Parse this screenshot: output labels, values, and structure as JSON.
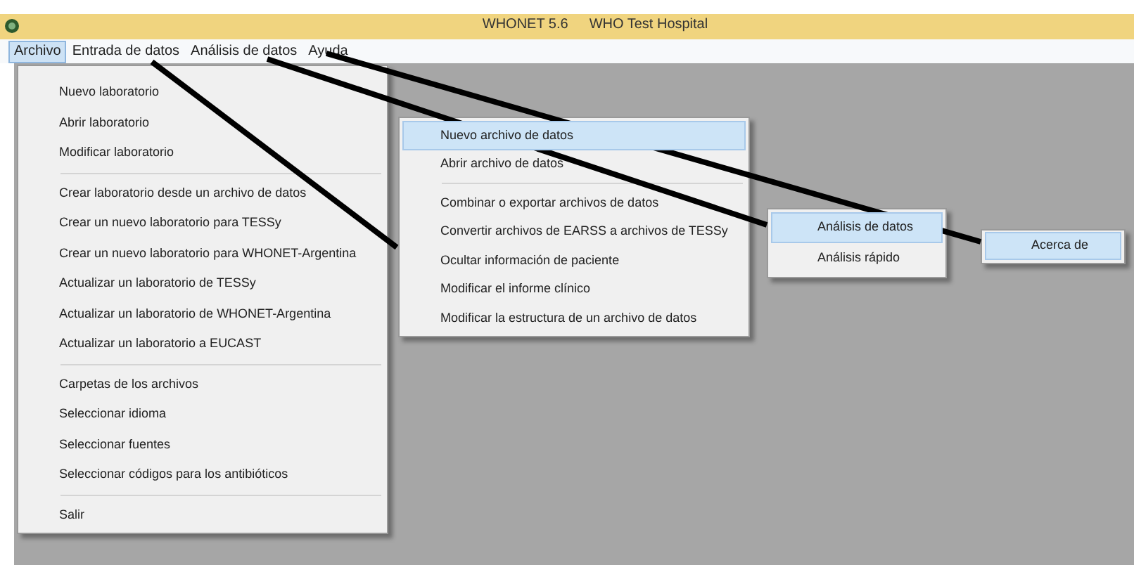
{
  "window": {
    "title": "WHONET 5.6",
    "subtitle": "WHO Test Hospital"
  },
  "menubar": [
    {
      "label": "Archivo",
      "selected": true
    },
    {
      "label": "Entrada de datos",
      "selected": false
    },
    {
      "label": "Análisis de datos",
      "selected": false
    },
    {
      "label": "Ayuda",
      "selected": false
    }
  ],
  "menus": [
    {
      "groups": [
        [
          {
            "label": "Nuevo laboratorio",
            "selected": false
          },
          {
            "label": "Abrir laboratorio",
            "selected": false
          },
          {
            "label": "Modificar laboratorio",
            "selected": false
          }
        ],
        [
          {
            "label": "Crear laboratorio desde un archivo de datos",
            "selected": false
          },
          {
            "label": "Crear un nuevo laboratorio para TESSy",
            "selected": false
          },
          {
            "label": "Crear un nuevo laboratorio para WHONET-Argentina",
            "selected": false
          },
          {
            "label": "Actualizar un laboratorio de TESSy",
            "selected": false
          },
          {
            "label": "Actualizar un laboratorio de WHONET-Argentina",
            "selected": false
          },
          {
            "label": "Actualizar un laboratorio a EUCAST",
            "selected": false
          }
        ],
        [
          {
            "label": "Carpetas de los archivos",
            "selected": false
          },
          {
            "label": "Seleccionar idioma",
            "selected": false
          },
          {
            "label": "Seleccionar fuentes",
            "selected": false
          },
          {
            "label": "Seleccionar  códigos para los antibióticos",
            "selected": false
          }
        ],
        [
          {
            "label": "Salir",
            "selected": false
          }
        ]
      ]
    },
    {
      "groups": [
        [
          {
            "label": "Nuevo archivo de datos",
            "selected": true
          },
          {
            "label": "Abrir archivo de datos",
            "selected": false
          }
        ],
        [
          {
            "label": "Combinar o exportar archivos de datos",
            "selected": false
          },
          {
            "label": "Convertir archivos de EARSS a archivos de TESSy",
            "selected": false
          },
          {
            "label": "Ocultar información de paciente",
            "selected": false
          },
          {
            "label": "Modificar el informe clínico",
            "selected": false
          },
          {
            "label": "Modificar la estructura de un archivo de datos",
            "selected": false
          }
        ]
      ]
    },
    {
      "groups": [
        [
          {
            "label": "Análisis de datos",
            "selected": true
          },
          {
            "label": "Análisis rápido",
            "selected": false
          }
        ]
      ]
    },
    {
      "groups": [
        [
          {
            "label": "Acerca de",
            "selected": true
          }
        ]
      ]
    }
  ]
}
